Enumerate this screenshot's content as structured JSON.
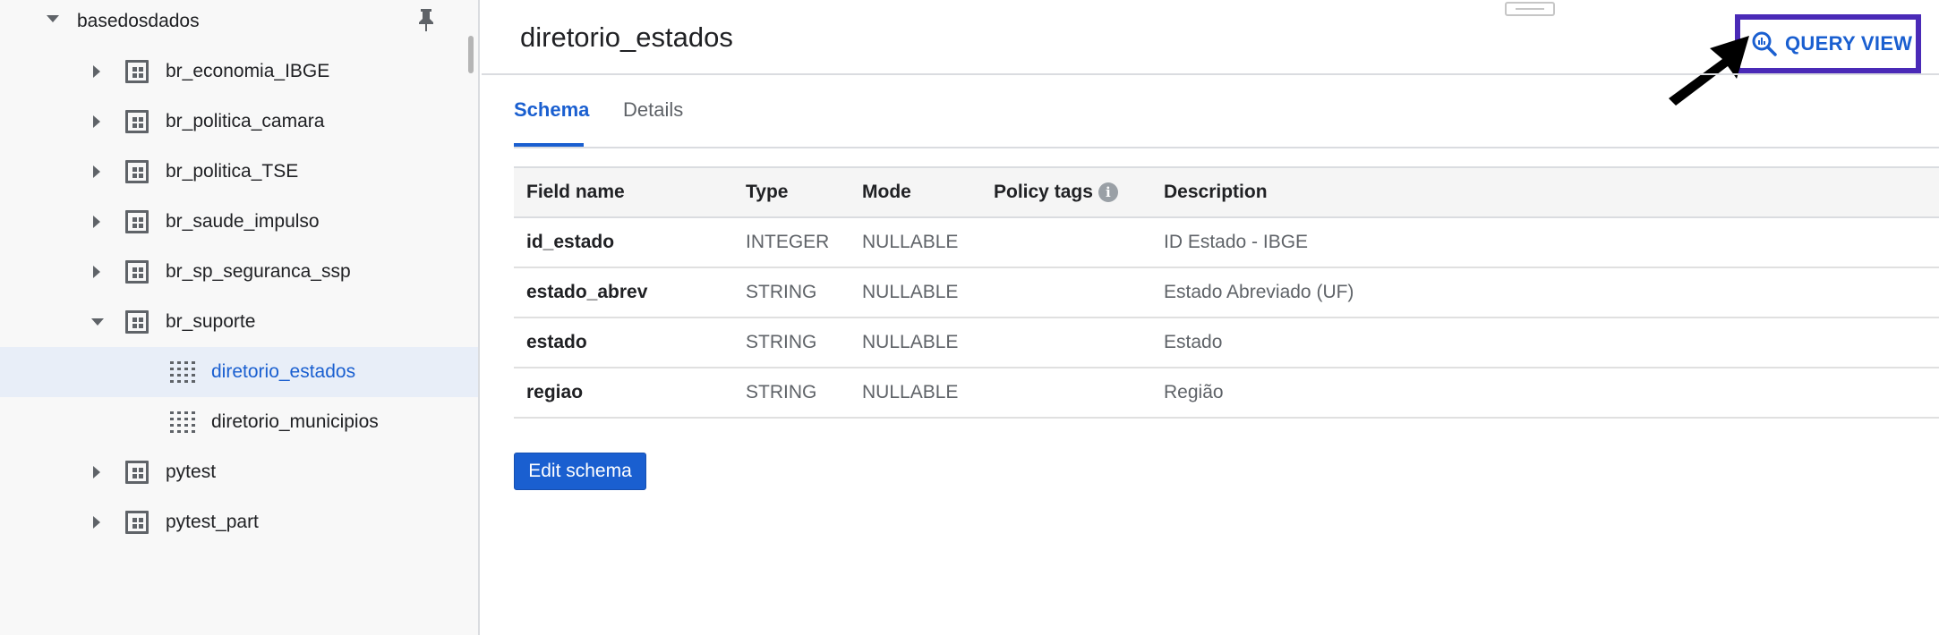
{
  "sidebar": {
    "root": {
      "label": "basedosdados",
      "expanded": true
    },
    "datasets": [
      {
        "label": "br_economia_IBGE",
        "expanded": false
      },
      {
        "label": "br_politica_camara",
        "expanded": false
      },
      {
        "label": "br_politica_TSE",
        "expanded": false
      },
      {
        "label": "br_saude_impulso",
        "expanded": false
      },
      {
        "label": "br_sp_seguranca_ssp",
        "expanded": false
      },
      {
        "label": "br_suporte",
        "expanded": true
      },
      {
        "label": "pytest",
        "expanded": false
      },
      {
        "label": "pytest_part",
        "expanded": false
      }
    ],
    "tables": [
      {
        "label": "diretorio_estados",
        "selected": true
      },
      {
        "label": "diretorio_municipios",
        "selected": false
      }
    ]
  },
  "main": {
    "title": "diretorio_estados",
    "query_button_label": "QUERY VIEW",
    "tabs": [
      {
        "label": "Schema",
        "active": true
      },
      {
        "label": "Details",
        "active": false
      }
    ],
    "schema": {
      "headers": [
        "Field name",
        "Type",
        "Mode",
        "Policy tags",
        "Description"
      ],
      "rows": [
        [
          "id_estado",
          "INTEGER",
          "NULLABLE",
          "",
          "ID Estado - IBGE"
        ],
        [
          "estado_abrev",
          "STRING",
          "NULLABLE",
          "",
          "Estado Abreviado (UF)"
        ],
        [
          "estado",
          "STRING",
          "NULLABLE",
          "",
          "Estado"
        ],
        [
          "regiao",
          "STRING",
          "NULLABLE",
          "",
          "Região"
        ]
      ]
    },
    "edit_schema_label": "Edit schema"
  },
  "colors": {
    "accent": "#1a5fd0",
    "highlight_border": "#4a2ab7",
    "selected_row_bg": "#e8eef8"
  },
  "icons": {
    "pin": "pin-icon",
    "dataset": "dataset-icon",
    "table": "table-icon",
    "query": "query-icon",
    "info": "info-icon",
    "annotation_arrow": "arrow-annotation-icon"
  }
}
